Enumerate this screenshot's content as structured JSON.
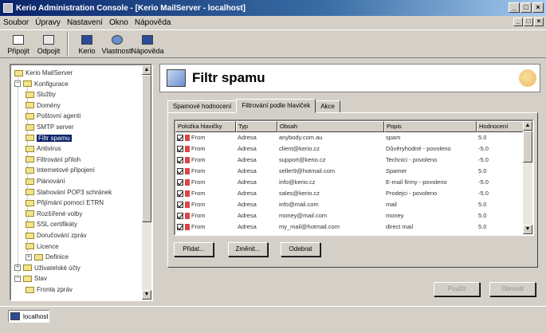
{
  "window": {
    "title": "Kerio Administration Console - [Kerio MailServer - localhost]",
    "menu": [
      "Soubor",
      "Úpravy",
      "Nastavení",
      "Okno",
      "Nápověda"
    ]
  },
  "toolbar": [
    {
      "label": "Připojit",
      "icon": "connect-icon"
    },
    {
      "label": "Odpojit",
      "icon": "disconnect-icon"
    },
    {
      "label": "Kerio",
      "icon": "monitor-icon"
    },
    {
      "label": "Vlastnosti",
      "icon": "globe-icon"
    },
    {
      "label": "Nápověda",
      "icon": "help-icon"
    }
  ],
  "tree": {
    "items": [
      {
        "label": "Kerio MailServer",
        "level": 0
      },
      {
        "label": "Konfigurace",
        "level": 0,
        "expander": "−"
      },
      {
        "label": "Služby",
        "level": 1
      },
      {
        "label": "Domény",
        "level": 1
      },
      {
        "label": "Poštovní agenti",
        "level": 1
      },
      {
        "label": "SMTP server",
        "level": 1
      },
      {
        "label": "Filtr spamu",
        "level": 1,
        "selected": true
      },
      {
        "label": "Antivirus",
        "level": 1
      },
      {
        "label": "Filtrování příloh",
        "level": 1
      },
      {
        "label": "Internetové připojení",
        "level": 1
      },
      {
        "label": "Plánování",
        "level": 1
      },
      {
        "label": "Stahování POP3 schránek",
        "level": 1
      },
      {
        "label": "Přijímání pomocí ETRN",
        "level": 1
      },
      {
        "label": "Rozšířené volby",
        "level": 1
      },
      {
        "label": "SSL certifikáty",
        "level": 1
      },
      {
        "label": "Doručování zpráv",
        "level": 1
      },
      {
        "label": "Licence",
        "level": 1
      },
      {
        "label": "Definice",
        "level": 1,
        "expander": "+"
      },
      {
        "label": "Uživatelské účty",
        "level": 0,
        "expander": "+"
      },
      {
        "label": "Stav",
        "level": 0,
        "expander": "−"
      },
      {
        "label": "Fronta zpráv",
        "level": 1
      }
    ]
  },
  "header": {
    "title": "Filtr spamu"
  },
  "tabs": [
    "Spamové hodnocení",
    "Filtrování podle hlaviček",
    "Akce"
  ],
  "grid": {
    "columns": [
      "Položka hlavičky",
      "Typ",
      "Obsah",
      "Popis",
      "Hodnocení"
    ],
    "rows": [
      {
        "item": "From",
        "type": "Adresa",
        "content": "anybody.com.au",
        "desc": "spam",
        "score": "5.0"
      },
      {
        "item": "From",
        "type": "Adresa",
        "content": "client@kerio.cz",
        "desc": "Důvěryhodné - povoleno",
        "score": "-5.0"
      },
      {
        "item": "From",
        "type": "Adresa",
        "content": "support@kerio.cz",
        "desc": "Technici - povoleno",
        "score": "-5.0"
      },
      {
        "item": "From",
        "type": "Adresa",
        "content": "seller9@hotmail.com",
        "desc": "Spamer",
        "score": "5.0"
      },
      {
        "item": "From",
        "type": "Adresa",
        "content": "info@kerio.cz",
        "desc": "E-mail firmy - povoleno",
        "score": "-5.0"
      },
      {
        "item": "From",
        "type": "Adresa",
        "content": "sales@kerio.cz",
        "desc": "Prodejci - povoleno",
        "score": "-5.0"
      },
      {
        "item": "From",
        "type": "Adresa",
        "content": "info@mail.com",
        "desc": "mail",
        "score": "5.0"
      },
      {
        "item": "From",
        "type": "Adresa",
        "content": "money@mail.com",
        "desc": "money",
        "score": "5.0"
      },
      {
        "item": "From",
        "type": "Adresa",
        "content": "my_mail@hotmail.com",
        "desc": "direct mail",
        "score": "5.0"
      }
    ]
  },
  "buttons": {
    "add": "Přidat...",
    "edit": "Změnit...",
    "remove": "Odebrat",
    "apply": "Použít",
    "revert": "Obnovit"
  },
  "statusbar": {
    "tab": "localhost"
  }
}
